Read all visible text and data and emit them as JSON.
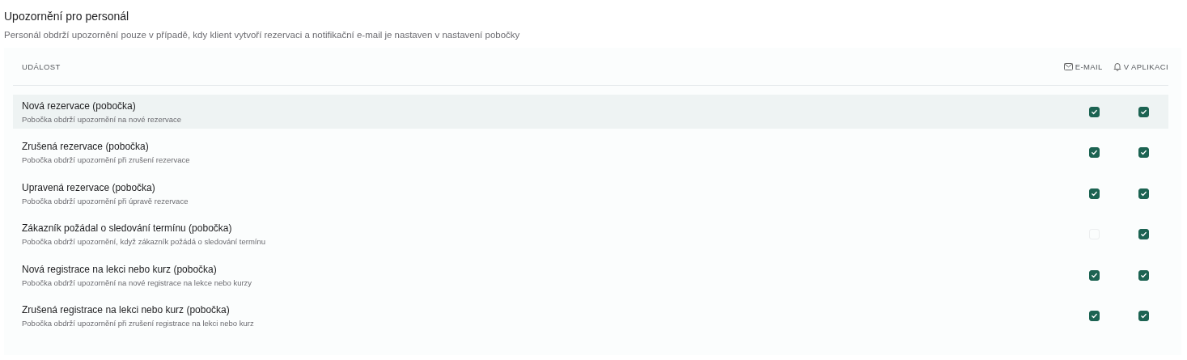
{
  "section": {
    "title": "Upozornění pro personál",
    "description": "Personál obdrží upozornění pouze v případě, kdy klient vytvoří rezervaci a notifikační e-mail je nastaven v nastavení pobočky"
  },
  "table": {
    "columns": [
      {
        "label": "UDÁLOST"
      },
      {
        "label": "E-MAIL"
      },
      {
        "label": "V APLIKACI"
      }
    ],
    "rows": [
      {
        "title": "Nová rezervace (pobočka)",
        "description": "Pobočka obdrží upozornění na nové rezervace",
        "selected": true,
        "email": true,
        "app": true
      },
      {
        "title": "Zrušená rezervace (pobočka)",
        "description": "Pobočka obdrží upozornění při zrušení rezervace",
        "selected": false,
        "email": true,
        "app": true
      },
      {
        "title": "Upravená rezervace (pobočka)",
        "description": "Pobočka obdrží upozornění při úpravě rezervace",
        "selected": false,
        "email": true,
        "app": true
      },
      {
        "title": "Zákazník požádal o sledování termínu (pobočka)",
        "description": "Pobočka obdrží upozornění, když zákazník požádá o sledování termínu",
        "selected": false,
        "email": false,
        "app": true
      },
      {
        "title": "Nová registrace na lekci nebo kurz (pobočka)",
        "description": "Pobočka obdrží upozornění na nové registrace na lekce nebo kurzy",
        "selected": false,
        "email": true,
        "app": true
      },
      {
        "title": "Zrušená registrace na lekci nebo kurz (pobočka)",
        "description": "Pobočka obdrží upozornění při zrušení registrace na lekci nebo kurz",
        "selected": false,
        "email": true,
        "app": true
      }
    ]
  }
}
